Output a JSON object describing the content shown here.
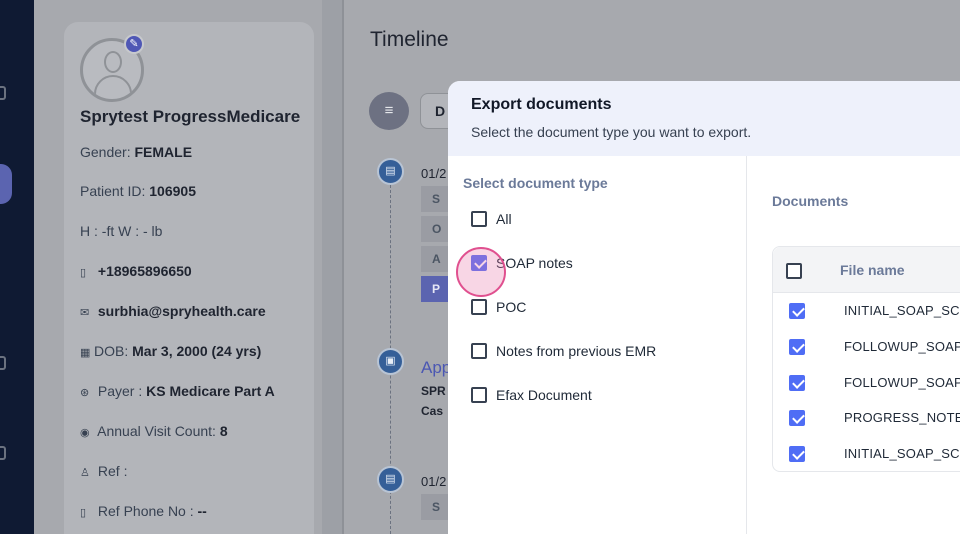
{
  "patient": {
    "name": "Sprytest ProgressMedicare",
    "gender_label": "Gender:",
    "gender": "FEMALE",
    "id_label": "Patient ID:",
    "id": "106905",
    "hw": "H : -ft W : - lb",
    "phone": "+18965896650",
    "email": "surbhia@spryhealth.care",
    "dob_label": "DOB:",
    "dob": "Mar 3, 2000 (24 yrs)",
    "payer_label": "Payer :",
    "payer": "KS Medicare Part A",
    "visit_label": "Annual Visit Count:",
    "visit": "8",
    "ref_label": "Ref :",
    "ref_phone_label": "Ref Phone No :",
    "ref_phone": "--"
  },
  "timeline": {
    "title": "Timeline",
    "select_partial": "D",
    "date1": "01/2",
    "date2": "01/2",
    "blocks": [
      "S",
      "O",
      "A",
      "P"
    ],
    "block2": "S",
    "appt_partial": "App",
    "sub1": "SPR",
    "sub2": "Cas"
  },
  "modal": {
    "title": "Export documents",
    "subtitle": "Select the document type you want to export.",
    "select_label": "Select document type",
    "options": [
      {
        "label": "All",
        "checked": false
      },
      {
        "label": "SOAP notes",
        "checked": true
      },
      {
        "label": "POC",
        "checked": false
      },
      {
        "label": "Notes from previous EMR",
        "checked": false
      },
      {
        "label": "Efax Document",
        "checked": false
      }
    ],
    "documents_label": "Documents",
    "file_col": "File name",
    "files": [
      "INITIAL_SOAP_SC",
      "FOLLOWUP_SOAP",
      "FOLLOWUP_SOAP",
      "PROGRESS_NOTE",
      "INITIAL_SOAP_SC"
    ]
  },
  "colors": {
    "accent": "#4f6df5",
    "rail": "#0f1a33",
    "timeline_dot": "#355f98"
  }
}
